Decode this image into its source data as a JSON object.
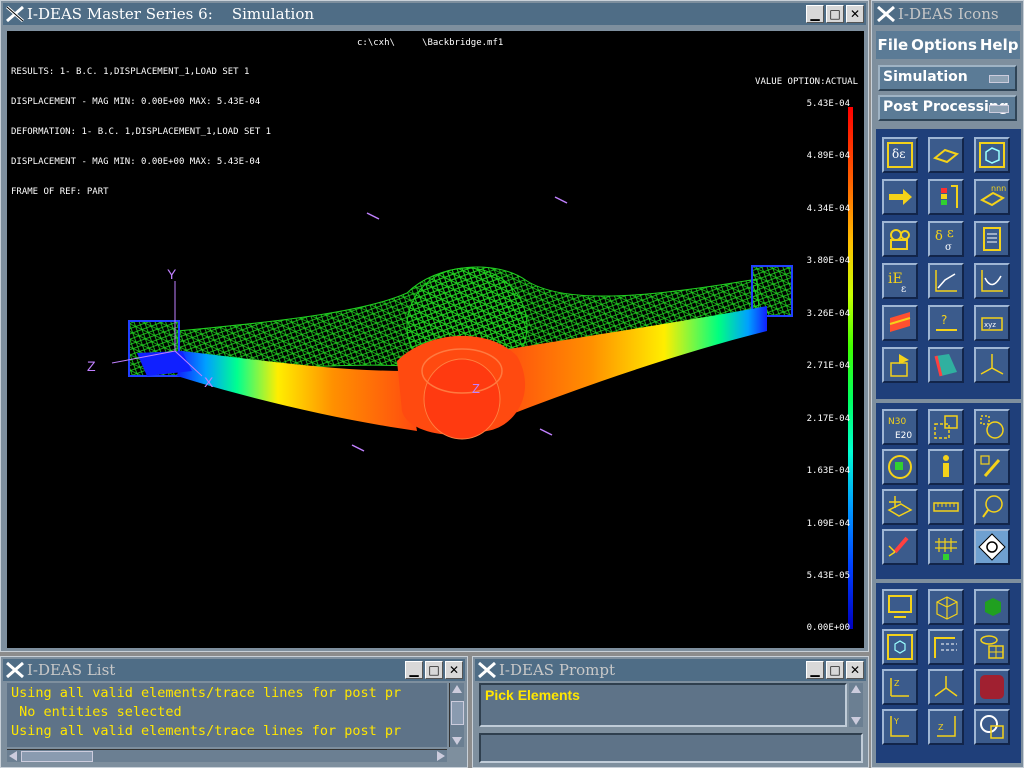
{
  "main_window": {
    "title": "I-DEAS Master Series 6:    Simulation",
    "viewport": {
      "header_lines": [
        "RESULTS: 1- B.C. 1,DISPLACEMENT_1,LOAD SET 1",
        "DISPLACEMENT - MAG MIN: 0.00E+00 MAX: 5.43E-04",
        "DEFORMATION: 1- B.C. 1,DISPLACEMENT_1,LOAD SET 1",
        "DISPLACEMENT - MAG MIN: 0.00E+00 MAX: 5.43E-04",
        "FRAME OF REF: PART"
      ],
      "file_path": "c:\\cxh\\     \\Backbridge.mf1",
      "value_option": "VALUE OPTION:ACTUAL",
      "legend": [
        "5.43E-04",
        "4.89E-04",
        "4.34E-04",
        "3.80E-04",
        "3.26E-04",
        "2.71E-04",
        "2.17E-04",
        "1.63E-04",
        "1.09E-04",
        "5.43E-05",
        "0.00E+00"
      ],
      "axes": {
        "y": "Y",
        "z": "Z",
        "x": "X",
        "z2": "Z"
      }
    }
  },
  "list_window": {
    "title": "I-DEAS List",
    "lines": [
      "Using all valid elements/trace lines for post pr",
      " No entities selected",
      "Using all valid elements/trace lines for post pr"
    ]
  },
  "prompt_window": {
    "title": "I-DEAS Prompt",
    "prompt_text": "Pick Elements",
    "input_value": ""
  },
  "icons_window": {
    "title": "I-DEAS Icons",
    "menu": {
      "file": "File",
      "options": "Options",
      "help": "Help"
    },
    "task": "Simulation",
    "subtask": "Post Processing",
    "colors": {
      "panel": "#1f3f7a",
      "icon_yellow": "#f4d21a"
    }
  }
}
